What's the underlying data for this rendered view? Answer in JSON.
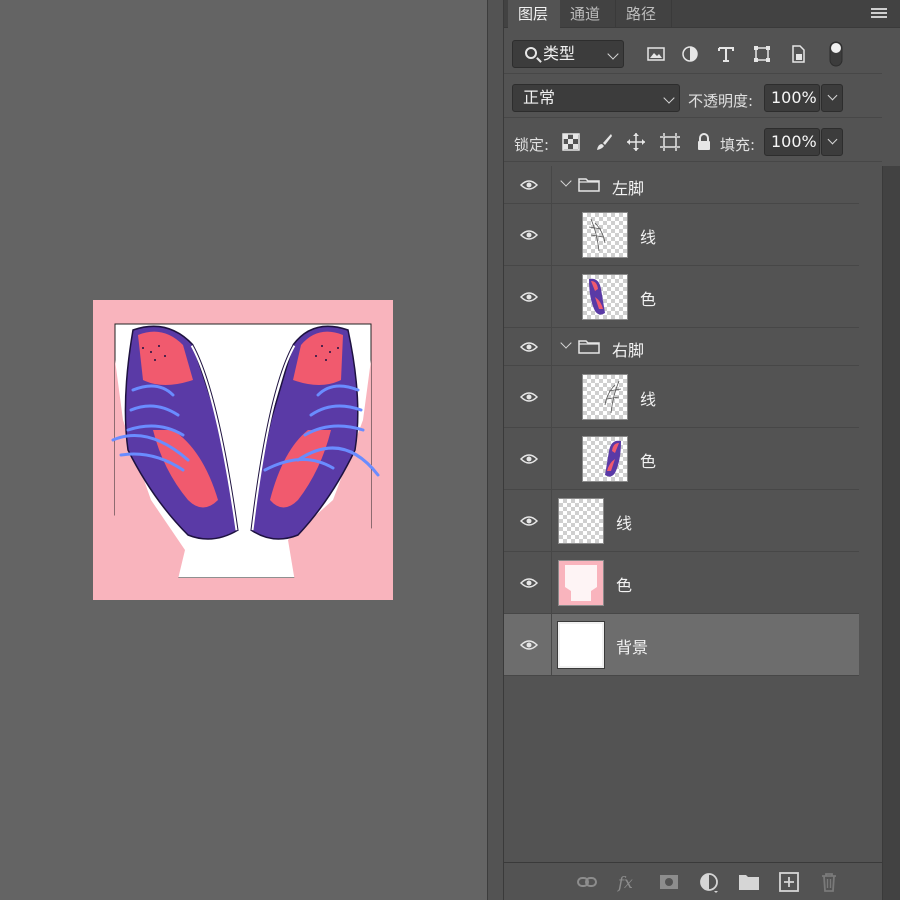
{
  "tabs": [
    {
      "label": "图层"
    },
    {
      "label": "通道"
    },
    {
      "label": "路径"
    }
  ],
  "filter": {
    "kind_label": "类型"
  },
  "blend": {
    "mode": "正常",
    "opacity_label": "不透明度:",
    "opacity_value": "100%"
  },
  "lock": {
    "label": "锁定:",
    "fill_label": "填充:",
    "fill_value": "100%"
  },
  "layers": [
    {
      "name": "左脚",
      "kind": "group"
    },
    {
      "name": "线",
      "kind": "layer"
    },
    {
      "name": "色",
      "kind": "layer"
    },
    {
      "name": "右脚",
      "kind": "group"
    },
    {
      "name": "线",
      "kind": "layer"
    },
    {
      "name": "色",
      "kind": "layer"
    },
    {
      "name": "线",
      "kind": "layer"
    },
    {
      "name": "色",
      "kind": "layer"
    },
    {
      "name": "背景",
      "kind": "background"
    }
  ],
  "colors": {
    "artwork_bg": "#f9b4bd",
    "shoe_purple": "#5a3aa6",
    "shoe_red": "#f15a6e",
    "lace_blue": "#6a8cff"
  }
}
